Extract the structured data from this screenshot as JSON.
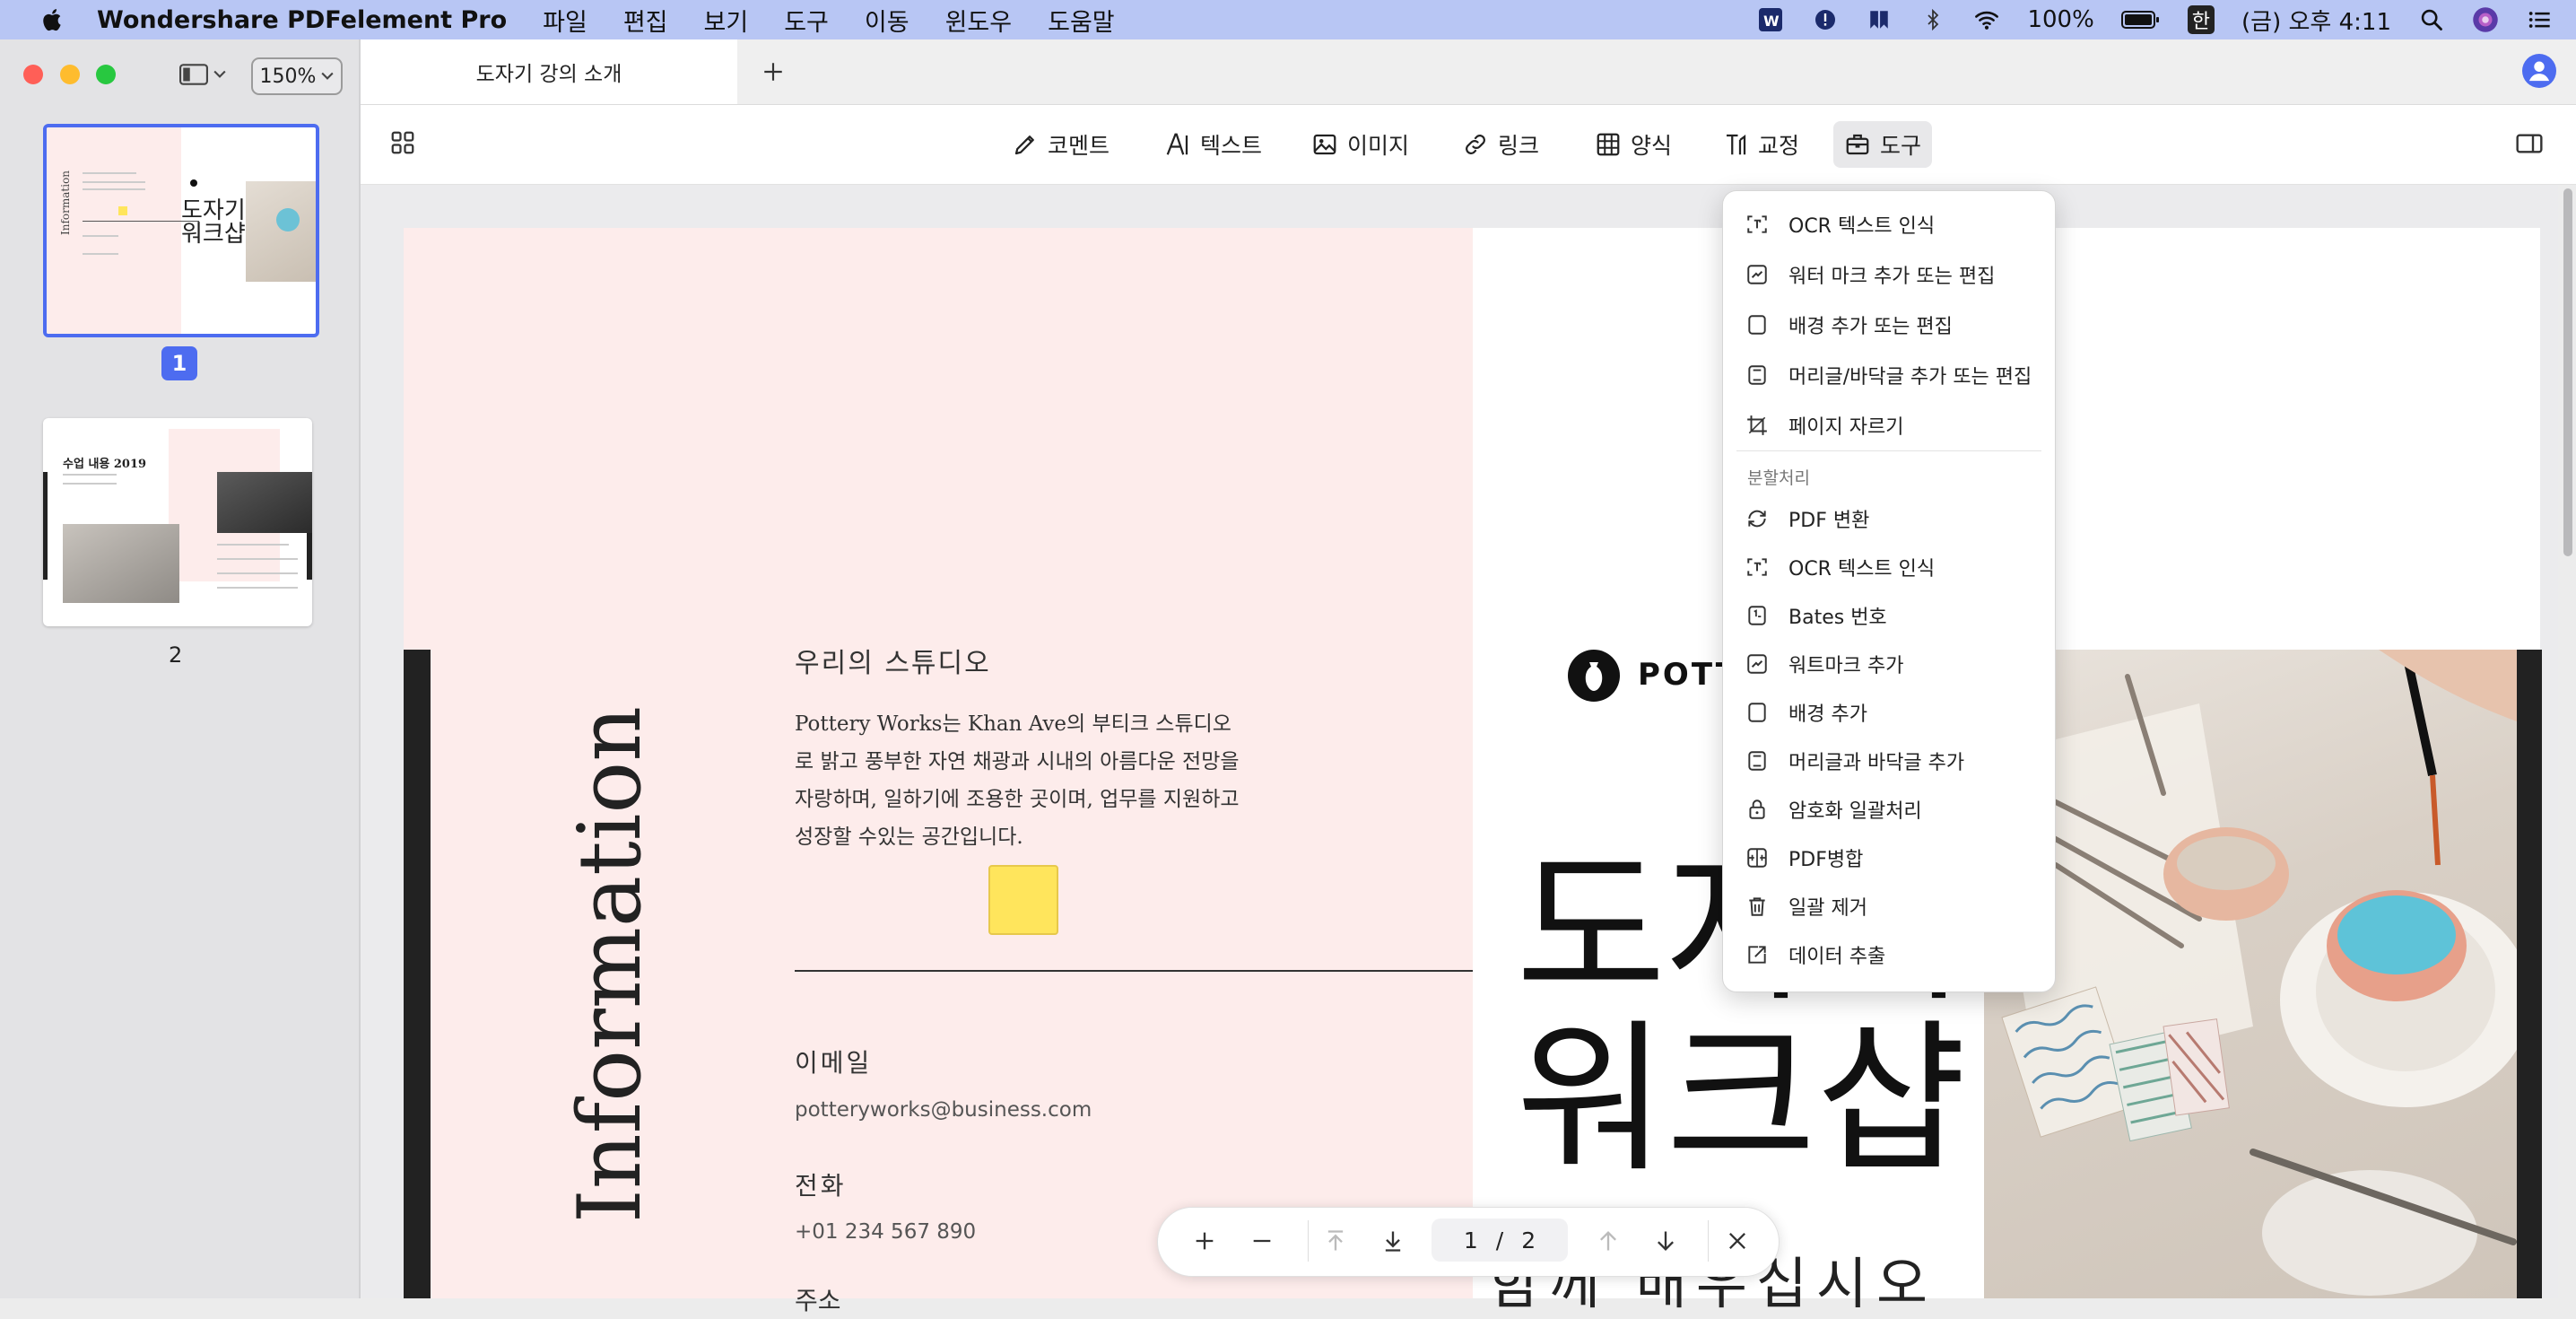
{
  "menubar": {
    "app_name": "Wondershare PDFelement Pro",
    "items": [
      "파일",
      "편집",
      "보기",
      "도구",
      "이동",
      "윈도우",
      "도움말"
    ],
    "battery": "100%",
    "input_method": "한",
    "clock": "(금) 오후 4:11"
  },
  "sidebar": {
    "zoom": "150%",
    "thumbnails": [
      {
        "page_label": "1",
        "selected": true
      },
      {
        "page_label": "2",
        "selected": false
      }
    ]
  },
  "tabs": [
    {
      "title": "도자기 강의 소개",
      "active": true
    }
  ],
  "toolbar": {
    "comment": "코멘트",
    "text": "텍스트",
    "image": "이미지",
    "link": "링크",
    "form": "양식",
    "correct": "교정",
    "tools": "도구"
  },
  "dropdown": {
    "items_top": [
      {
        "label": "OCR 텍스트 인식",
        "icon": "ocr-icon"
      },
      {
        "label": "워터 마크 추가 또는 편집",
        "icon": "watermark-icon"
      },
      {
        "label": "배경 추가 또는 편집",
        "icon": "background-icon"
      },
      {
        "label": "머리글/바닥글 추가 또는 편집",
        "icon": "header-footer-icon"
      },
      {
        "label": "페이지 자르기",
        "icon": "crop-icon"
      }
    ],
    "section_title": "분할처리",
    "items_batch": [
      {
        "label": "PDF 변환",
        "icon": "convert-icon"
      },
      {
        "label": "OCR 텍스트 인식",
        "icon": "ocr-icon"
      },
      {
        "label": "Bates 번호",
        "icon": "bates-icon"
      },
      {
        "label": "워트마크 추가",
        "icon": "watermark-icon"
      },
      {
        "label": "배경 추가",
        "icon": "background-icon"
      },
      {
        "label": "머리글과 바닥글 추가",
        "icon": "header-footer-icon"
      },
      {
        "label": "암호화 일괄처리",
        "icon": "lock-icon"
      },
      {
        "label": "PDF병합",
        "icon": "merge-icon"
      },
      {
        "label": "일괄 제거",
        "icon": "trash-icon"
      },
      {
        "label": "데이터 추출",
        "icon": "export-icon"
      }
    ]
  },
  "document": {
    "vertical_title": "Information",
    "studio_heading": "우리의 스튜디오",
    "studio_body": "Pottery Works는 Khan Ave의 부티크 스튜디오로 밝고 풍부한 자연 채광과 시내의 아름다운 전망을 자랑하며, 일하기에 조용한 곳이며, 업무를 지원하고 성장할 수있는 공간입니다.",
    "email_label": "이메일",
    "email_value": "potteryworks@business.com",
    "phone_label": "전화",
    "phone_value": "+01 234 567 890",
    "address_label": "주소",
    "logo_text": "POTTERY WORKS",
    "big_title_1": "도자기",
    "big_title_2": "워크샵",
    "sub_title": "함께 배우십시오"
  },
  "pagenav": {
    "current_page": "1",
    "separator": "/",
    "total_pages": "2"
  },
  "colors": {
    "accent": "#4d6cf0",
    "menubar": "#b8c6f4",
    "page_pink": "#fdeceb",
    "sticky_note": "#ffe55c"
  }
}
